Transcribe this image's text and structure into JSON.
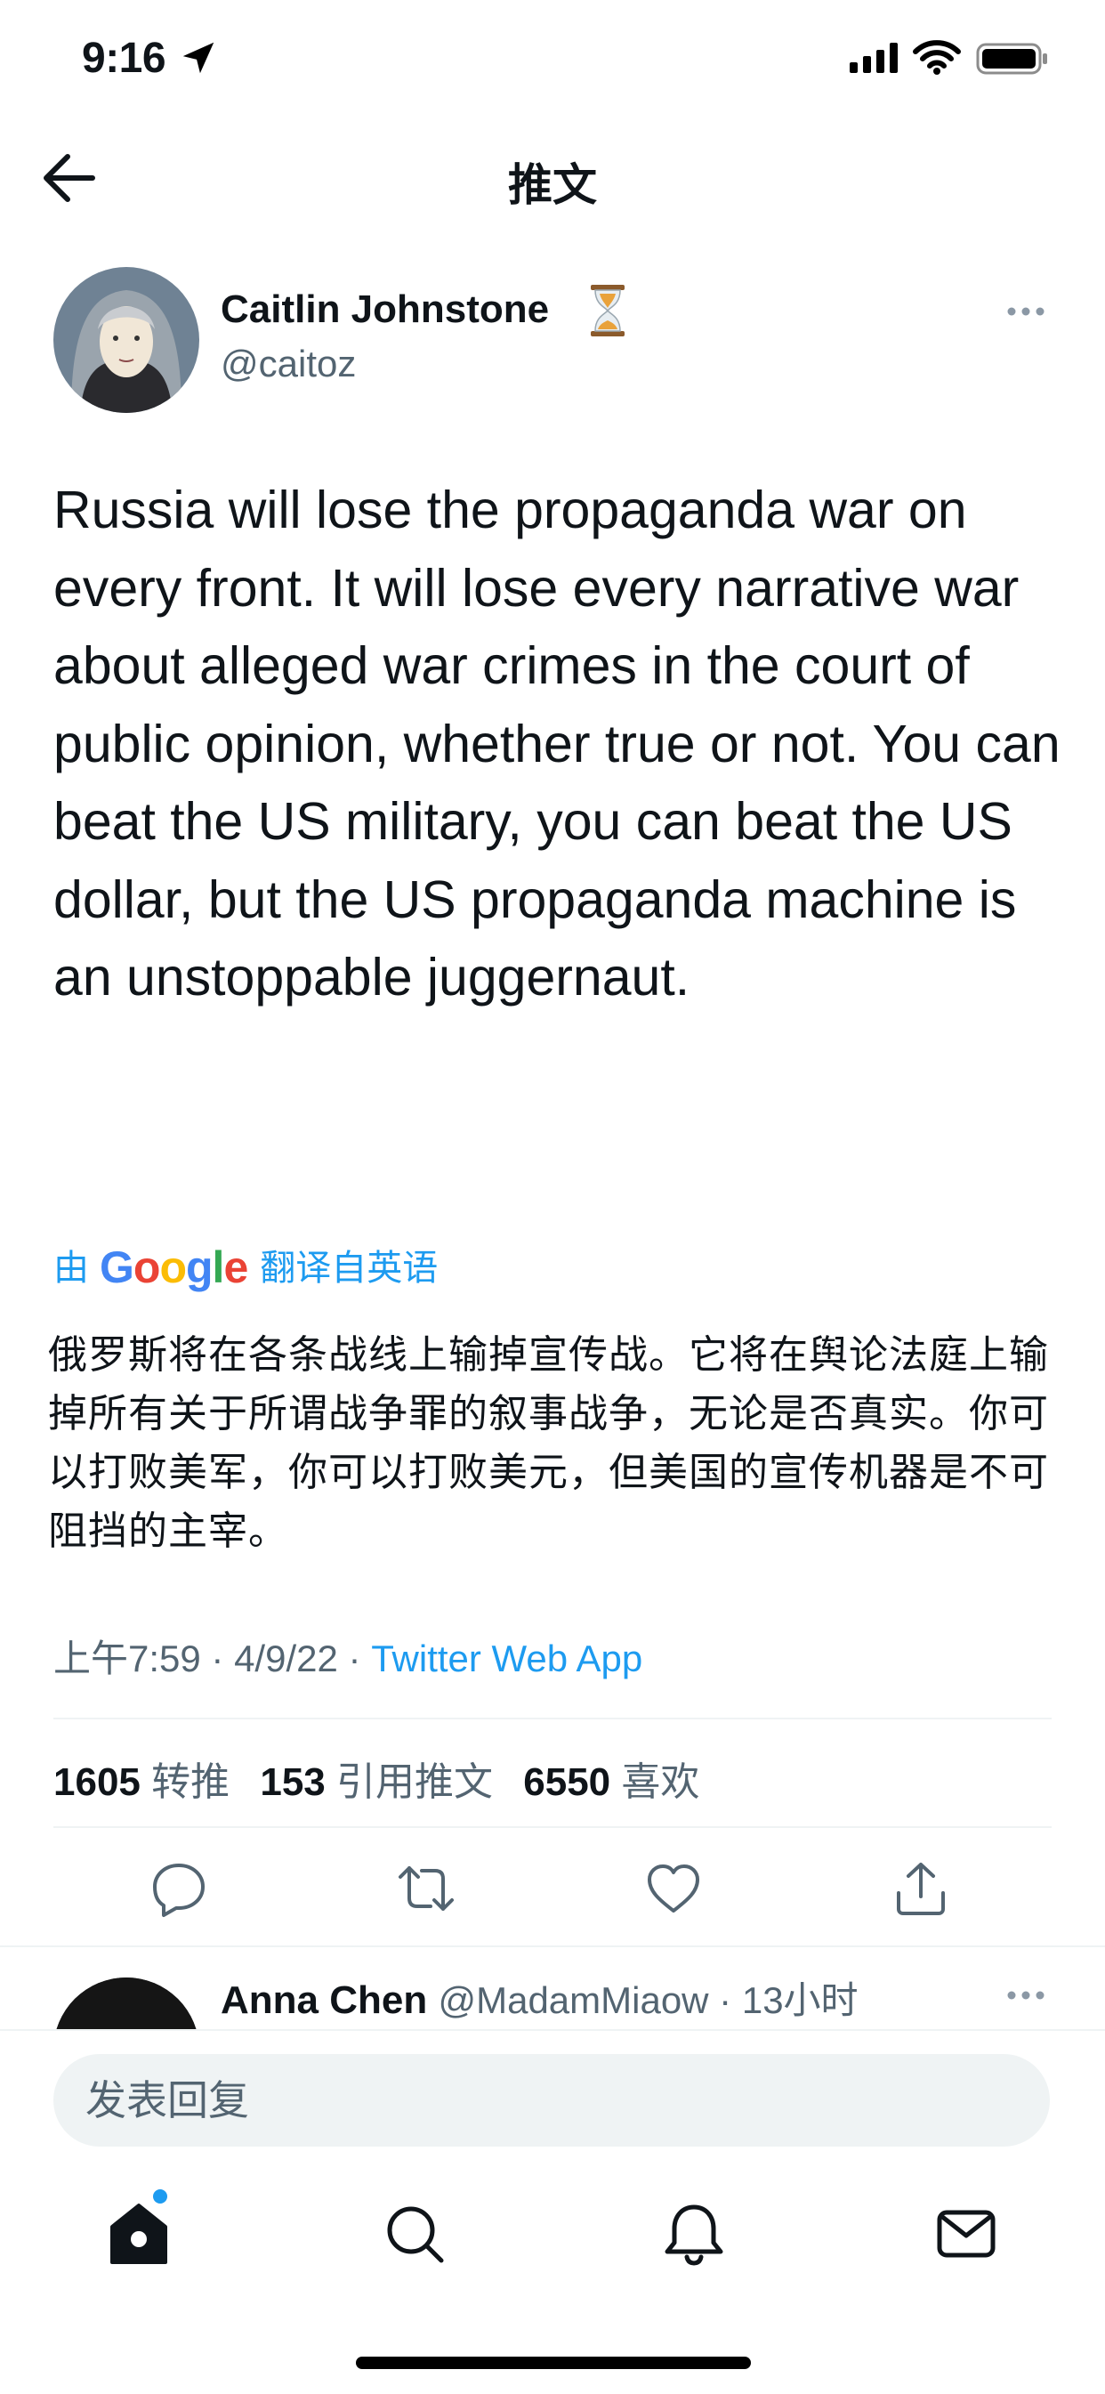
{
  "status_bar": {
    "time": "9:16"
  },
  "header": {
    "title": "推文"
  },
  "tweet": {
    "author_name": "Caitlin Johnstone",
    "author_handle": "@caitoz",
    "text": "Russia will lose the propaganda war on every front. It will lose every narrative war about alleged war crimes in the court of public opinion, whether true or not. You can beat the US military, you can beat the US dollar, but the US propaganda machine is an unstoppable juggernaut.",
    "translation": {
      "prefix": "由",
      "provider": "Google",
      "suffix": "翻译自英语",
      "text": "俄罗斯将在各条战线上输掉宣传战。它将在舆论法庭上输掉所有关于所谓战争罪的叙事战争，无论是否真实。你可以打败美军，你可以打败美元，但美国的宣传机器是不可阻挡的主宰。"
    },
    "meta": {
      "time": "上午7:59",
      "separator": " · ",
      "date": "4/9/22",
      "source": "Twitter Web App"
    },
    "stats": {
      "retweets_count": "1605",
      "retweets_label": "转推",
      "quotes_count": "153",
      "quotes_label": "引用推文",
      "likes_count": "6550",
      "likes_label": "喜欢"
    }
  },
  "reply_preview": {
    "name": "Anna Chen",
    "handle": "@MadamMiaow · 13小时"
  },
  "compose": {
    "placeholder": "发表回复"
  },
  "colors": {
    "accent": "#1d9bf0",
    "secondary_text": "#536471",
    "divider": "#eff3f4"
  }
}
